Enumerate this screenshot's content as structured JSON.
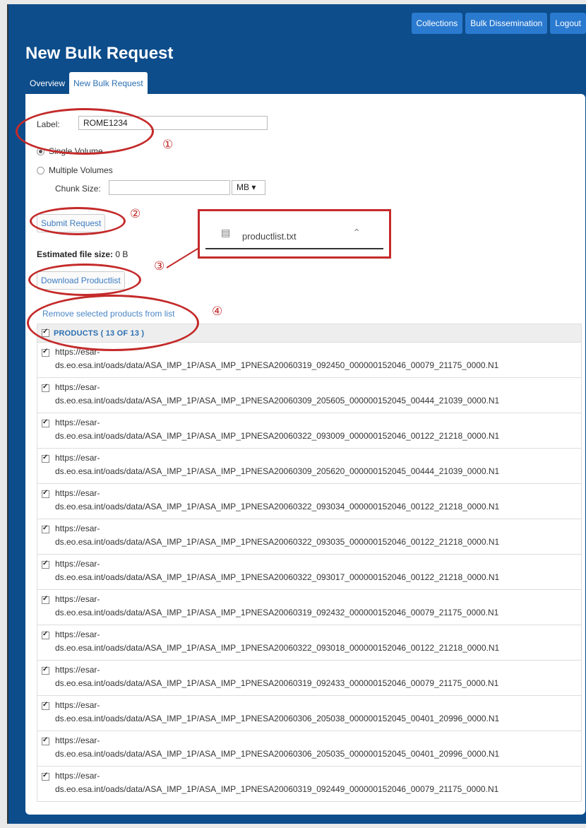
{
  "nav": {
    "collections": "Collections",
    "bulk_dissemination": "Bulk Dissemination",
    "logout": "Logout"
  },
  "page_title": "New Bulk Request",
  "tabs": [
    "Overview",
    "New Bulk Request"
  ],
  "form": {
    "label_text": "Label:",
    "label_value": "ROME1234",
    "single_volume": "Single Volume",
    "multiple_volumes": "Multiple Volumes",
    "chunk_size_label": "Chunk Size:",
    "chunk_size_value": "",
    "unit": "MB ▾",
    "submit": "Submit Request",
    "estimated_label": "Estimated file size:",
    "estimated_value": "0 B",
    "download": "Download Productlist",
    "remove": "Remove selected products from list"
  },
  "table": {
    "header": "PRODUCTS ( 13 OF 13 )",
    "prefix": "https://esar-",
    "rows": [
      "ds.eo.esa.int/oads/data/ASA_IMP_1P/ASA_IMP_1PNESA20060319_092450_000000152046_00079_21175_0000.N1",
      "ds.eo.esa.int/oads/data/ASA_IMP_1P/ASA_IMP_1PNESA20060309_205605_000000152045_00444_21039_0000.N1",
      "ds.eo.esa.int/oads/data/ASA_IMP_1P/ASA_IMP_1PNESA20060322_093009_000000152046_00122_21218_0000.N1",
      "ds.eo.esa.int/oads/data/ASA_IMP_1P/ASA_IMP_1PNESA20060309_205620_000000152045_00444_21039_0000.N1",
      "ds.eo.esa.int/oads/data/ASA_IMP_1P/ASA_IMP_1PNESA20060322_093034_000000152046_00122_21218_0000.N1",
      "ds.eo.esa.int/oads/data/ASA_IMP_1P/ASA_IMP_1PNESA20060322_093035_000000152046_00122_21218_0000.N1",
      "ds.eo.esa.int/oads/data/ASA_IMP_1P/ASA_IMP_1PNESA20060322_093017_000000152046_00122_21218_0000.N1",
      "ds.eo.esa.int/oads/data/ASA_IMP_1P/ASA_IMP_1PNESA20060319_092432_000000152046_00079_21175_0000.N1",
      "ds.eo.esa.int/oads/data/ASA_IMP_1P/ASA_IMP_1PNESA20060322_093018_000000152046_00122_21218_0000.N1",
      "ds.eo.esa.int/oads/data/ASA_IMP_1P/ASA_IMP_1PNESA20060319_092433_000000152046_00079_21175_0000.N1",
      "ds.eo.esa.int/oads/data/ASA_IMP_1P/ASA_IMP_1PNESA20060306_205038_000000152045_00401_20996_0000.N1",
      "ds.eo.esa.int/oads/data/ASA_IMP_1P/ASA_IMP_1PNESA20060306_205035_000000152045_00401_20996_0000.N1",
      "ds.eo.esa.int/oads/data/ASA_IMP_1P/ASA_IMP_1PNESA20060319_092449_000000152046_00079_21175_0000.N1"
    ]
  },
  "download_popup": {
    "filename": "productlist.txt"
  },
  "annotations": [
    "①",
    "②",
    "③",
    "④"
  ]
}
